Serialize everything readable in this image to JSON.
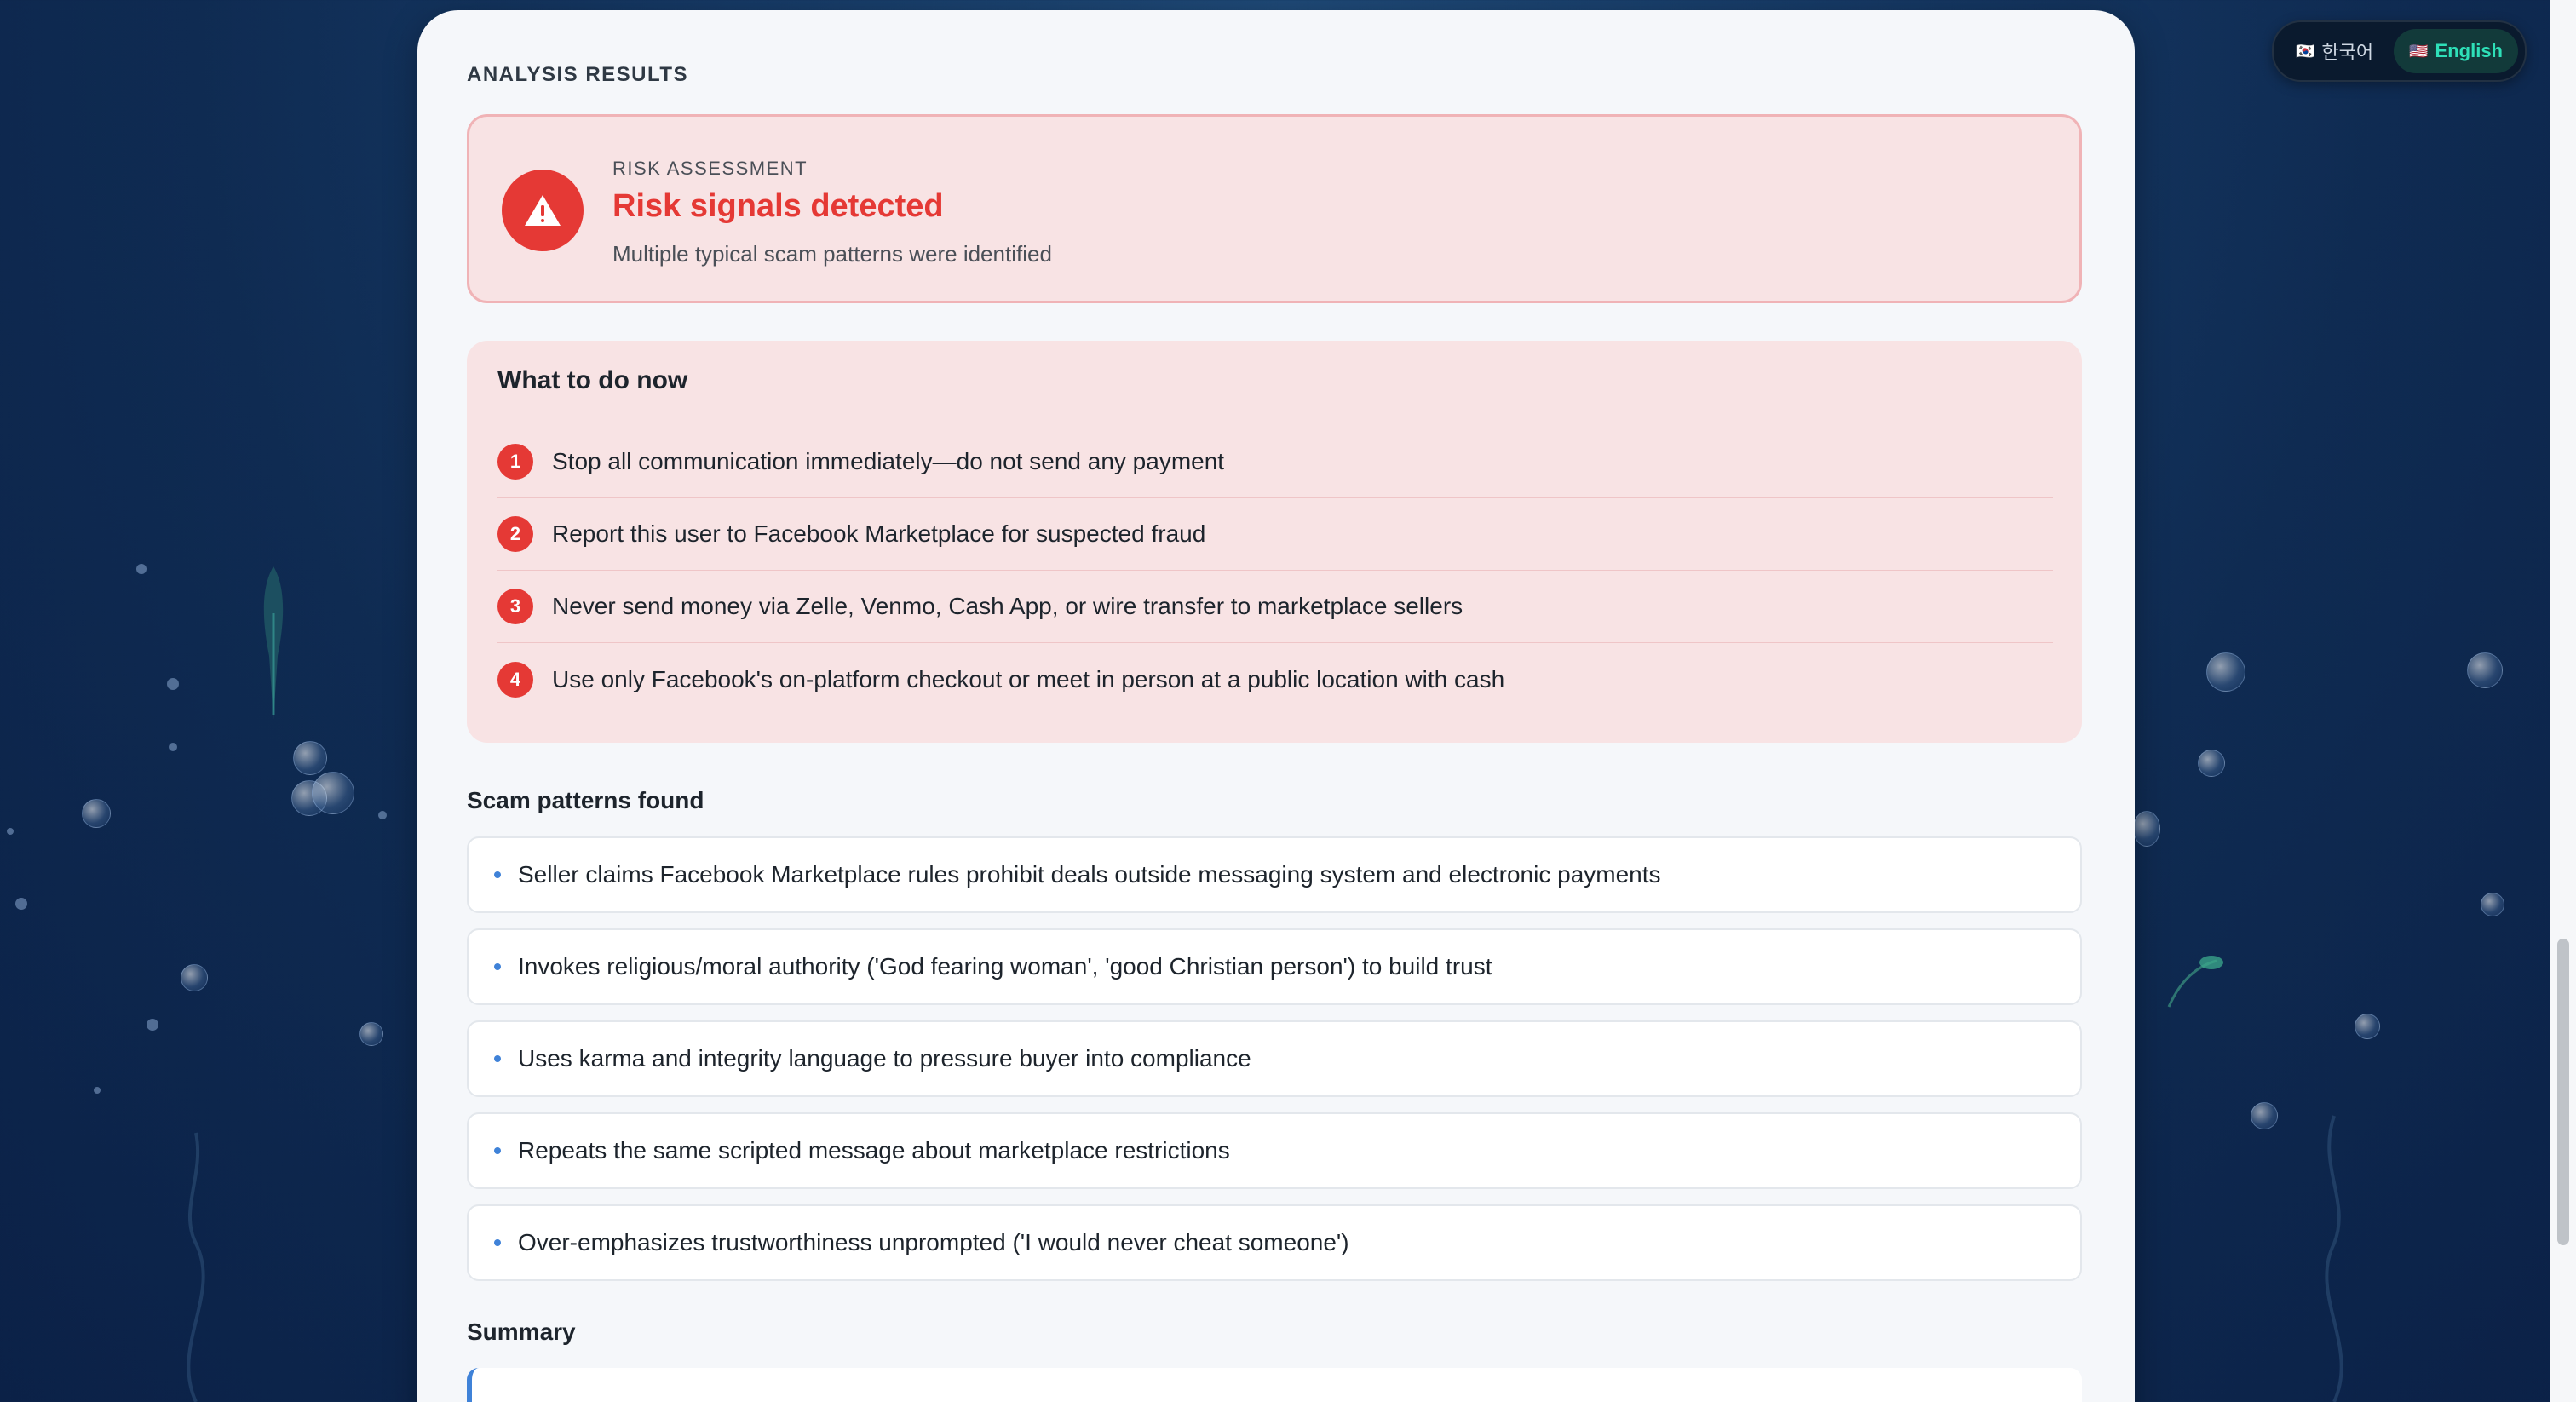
{
  "language_switcher": {
    "korean_label": "한국어",
    "english_label": "English",
    "korean_flag": "🇰🇷",
    "english_flag": "🇺🇸",
    "active": "English"
  },
  "analysis": {
    "section_label": "ANALYSIS RESULTS",
    "risk": {
      "kicker": "RISK ASSESSMENT",
      "title": "Risk signals detected",
      "subtitle": "Multiple typical scam patterns were identified",
      "icon": "warning-icon"
    },
    "todo": {
      "title": "What to do now",
      "items": [
        {
          "num": "1",
          "text": "Stop all communication immediately—do not send any payment"
        },
        {
          "num": "2",
          "text": "Report this user to Facebook Marketplace for suspected fraud"
        },
        {
          "num": "3",
          "text": "Never send money via Zelle, Venmo, Cash App, or wire transfer to marketplace sellers"
        },
        {
          "num": "4",
          "text": "Use only Facebook's on-platform checkout or meet in person at a public location with cash"
        }
      ]
    },
    "patterns": {
      "title": "Scam patterns found",
      "items": [
        "Seller claims Facebook Marketplace rules prohibit deals outside messaging system and electronic payments",
        "Invokes religious/moral authority ('God fearing woman', 'good Christian person') to build trust",
        "Uses karma and integrity language to pressure buyer into compliance",
        "Repeats the same scripted message about marketplace restrictions",
        "Over-emphasizes trustworthiness unprompted ('I would never cheat someone')"
      ]
    },
    "summary": {
      "title": "Summary"
    }
  },
  "colors": {
    "danger": "#e53935",
    "danger_bg": "#f8e3e4",
    "accent_blue": "#3f82d8",
    "active_lang": "#2ee0b8"
  }
}
